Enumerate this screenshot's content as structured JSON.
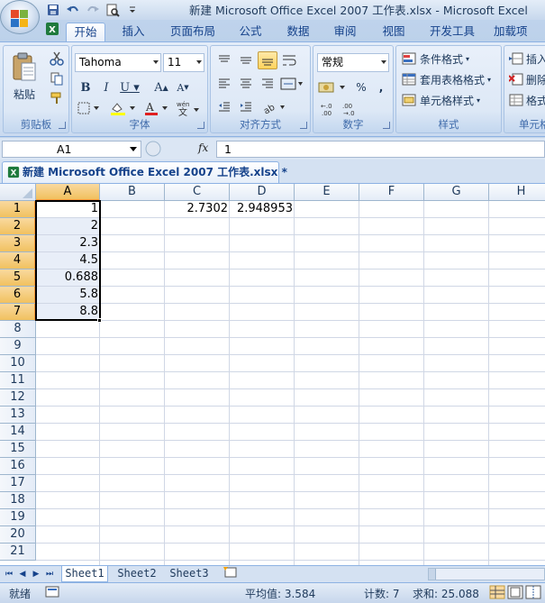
{
  "window": {
    "title": "新建 Microsoft Office Excel 2007 工作表.xlsx - Microsoft Excel"
  },
  "ribbon": {
    "tabs": [
      "开始",
      "插入",
      "页面布局",
      "公式",
      "数据",
      "审阅",
      "视图",
      "开发工具",
      "加载项"
    ],
    "active_tab": "开始",
    "clipboard": {
      "label": "剪贴板",
      "paste_label": "粘贴"
    },
    "font": {
      "label": "字体",
      "font_name": "Tahoma",
      "font_size": "11"
    },
    "alignment": {
      "label": "对齐方式"
    },
    "number": {
      "label": "数字",
      "format": "常规",
      "percent": "%",
      "comma": ","
    },
    "styles": {
      "label": "样式",
      "conditional": "条件格式",
      "table_format": "套用表格格式",
      "cell_styles": "单元格样式"
    },
    "cells": {
      "label": "单元格",
      "insert": "插入",
      "delete": "删除",
      "format": "格式"
    }
  },
  "formula_bar": {
    "name_box": "A1",
    "fx": "fx",
    "content": "1"
  },
  "workbook_tab": {
    "label": "新建 Microsoft Office Excel 2007 工作表.xlsx *"
  },
  "sheet": {
    "columns": [
      "A",
      "B",
      "C",
      "D",
      "E",
      "F",
      "G",
      "H"
    ],
    "rows": [
      "1",
      "2",
      "3",
      "4",
      "5",
      "6",
      "7",
      "8",
      "9",
      "10",
      "11",
      "12",
      "13",
      "14",
      "15",
      "16",
      "17",
      "18",
      "19",
      "20",
      "21"
    ],
    "cells": {
      "A1": "1",
      "A2": "2",
      "A3": "2.3",
      "A4": "4.5",
      "A5": "0.688",
      "A6": "5.8",
      "A7": "8.8",
      "C1": "2.7302",
      "D1": "2.948953"
    }
  },
  "sheet_tabs": [
    "Sheet1",
    "Sheet2",
    "Sheet3"
  ],
  "active_sheet": "Sheet1",
  "status_bar": {
    "ready": "就绪",
    "average": "平均值: 3.584",
    "count": "计数: 7",
    "sum": "求和: 25.088"
  }
}
